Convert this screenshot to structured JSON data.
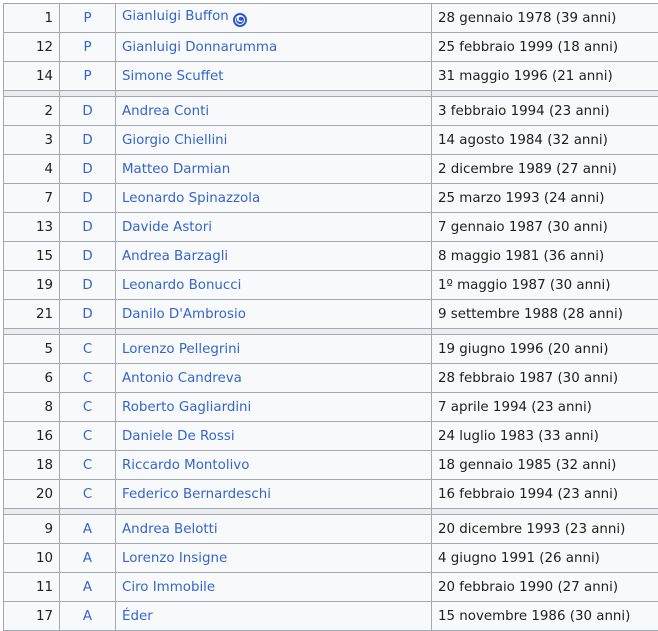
{
  "captain_badge": "C",
  "groups": [
    {
      "players": [
        {
          "number": "1",
          "position": "P",
          "name": "Gianluigi Buffon",
          "birth": "28 gennaio 1978 (39 anni)",
          "captain": true
        },
        {
          "number": "12",
          "position": "P",
          "name": "Gianluigi Donnarumma",
          "birth": "25 febbraio 1999 (18 anni)"
        },
        {
          "number": "14",
          "position": "P",
          "name": "Simone Scuffet",
          "birth": "31 maggio 1996 (21 anni)"
        }
      ]
    },
    {
      "players": [
        {
          "number": "2",
          "position": "D",
          "name": "Andrea Conti",
          "birth": "3 febbraio 1994 (23 anni)"
        },
        {
          "number": "3",
          "position": "D",
          "name": "Giorgio Chiellini",
          "birth": "14 agosto 1984 (32 anni)"
        },
        {
          "number": "4",
          "position": "D",
          "name": "Matteo Darmian",
          "birth": "2 dicembre 1989 (27 anni)"
        },
        {
          "number": "7",
          "position": "D",
          "name": "Leonardo Spinazzola",
          "birth": "25 marzo 1993 (24 anni)"
        },
        {
          "number": "13",
          "position": "D",
          "name": "Davide Astori",
          "birth": "7 gennaio 1987 (30 anni)"
        },
        {
          "number": "15",
          "position": "D",
          "name": "Andrea Barzagli",
          "birth": "8 maggio 1981 (36 anni)"
        },
        {
          "number": "19",
          "position": "D",
          "name": "Leonardo Bonucci",
          "birth": "1º maggio 1987 (30 anni)"
        },
        {
          "number": "21",
          "position": "D",
          "name": "Danilo D'Ambrosio",
          "birth": "9 settembre 1988 (28 anni)"
        }
      ]
    },
    {
      "players": [
        {
          "number": "5",
          "position": "C",
          "name": "Lorenzo Pellegrini",
          "birth": "19 giugno 1996 (20 anni)"
        },
        {
          "number": "6",
          "position": "C",
          "name": "Antonio Candreva",
          "birth": "28 febbraio 1987 (30 anni)"
        },
        {
          "number": "8",
          "position": "C",
          "name": "Roberto Gagliardini",
          "birth": "7 aprile 1994 (23 anni)"
        },
        {
          "number": "16",
          "position": "C",
          "name": "Daniele De Rossi",
          "birth": "24 luglio 1983 (33 anni)"
        },
        {
          "number": "18",
          "position": "C",
          "name": "Riccardo Montolivo",
          "birth": "18 gennaio 1985 (32 anni)"
        },
        {
          "number": "20",
          "position": "C",
          "name": "Federico Bernardeschi",
          "birth": "16 febbraio 1994 (23 anni)"
        }
      ]
    },
    {
      "players": [
        {
          "number": "9",
          "position": "A",
          "name": "Andrea Belotti",
          "birth": "20 dicembre 1993 (23 anni)"
        },
        {
          "number": "10",
          "position": "A",
          "name": "Lorenzo Insigne",
          "birth": "4 giugno 1991 (26 anni)"
        },
        {
          "number": "11",
          "position": "A",
          "name": "Ciro Immobile",
          "birth": "20 febbraio 1990 (27 anni)"
        },
        {
          "number": "17",
          "position": "A",
          "name": "Éder",
          "birth": "15 novembre 1986 (30 anni)"
        }
      ]
    }
  ],
  "colors": {
    "link": "#3366cc",
    "border": "#a2a9b1",
    "row_bg": "#f8f9fa",
    "separator_bg": "#eaecf0",
    "captain_badge": "#2f58d6"
  }
}
